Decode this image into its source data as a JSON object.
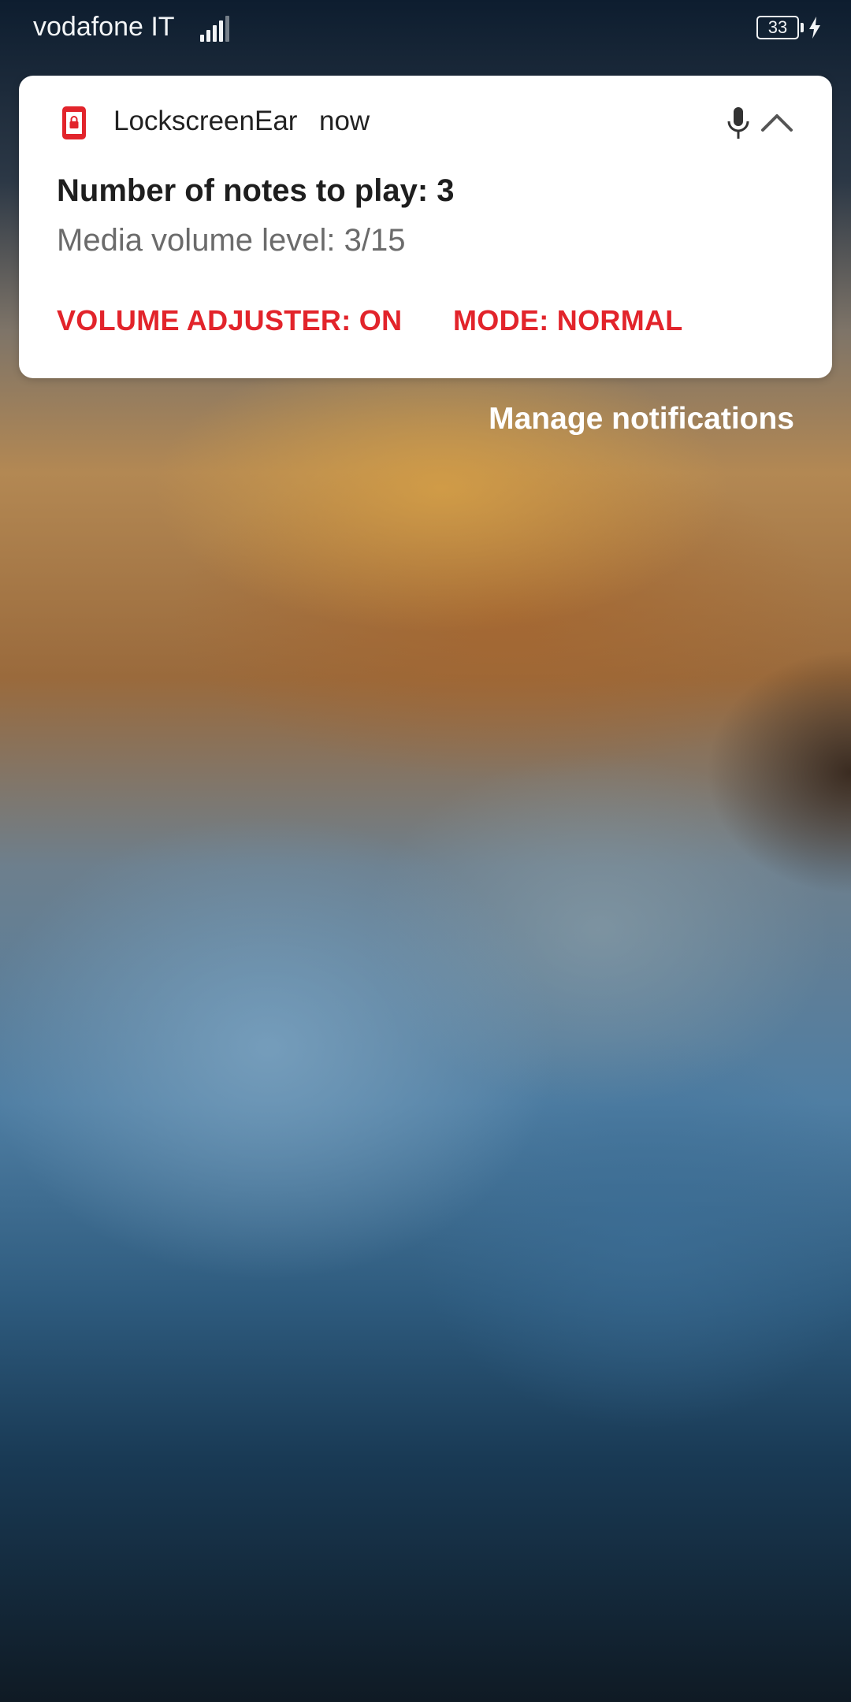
{
  "status_bar": {
    "carrier": "vodafone IT",
    "battery_level": "33",
    "icons": [
      "signal-icon",
      "battery-icon",
      "charging-icon"
    ]
  },
  "notification": {
    "app_name": "LockscreenEar",
    "time": "now",
    "title": "Number of notes to play: 3",
    "text": "Media volume level: 3/15",
    "actions": [
      {
        "label": "VOLUME ADJUSTER: ON"
      },
      {
        "label": "MODE: NORMAL"
      }
    ],
    "icons": [
      "app-lock-icon",
      "mic-icon",
      "chevron-up-icon"
    ],
    "accent_color": "#e2242b"
  },
  "manage_label": "Manage notifications"
}
